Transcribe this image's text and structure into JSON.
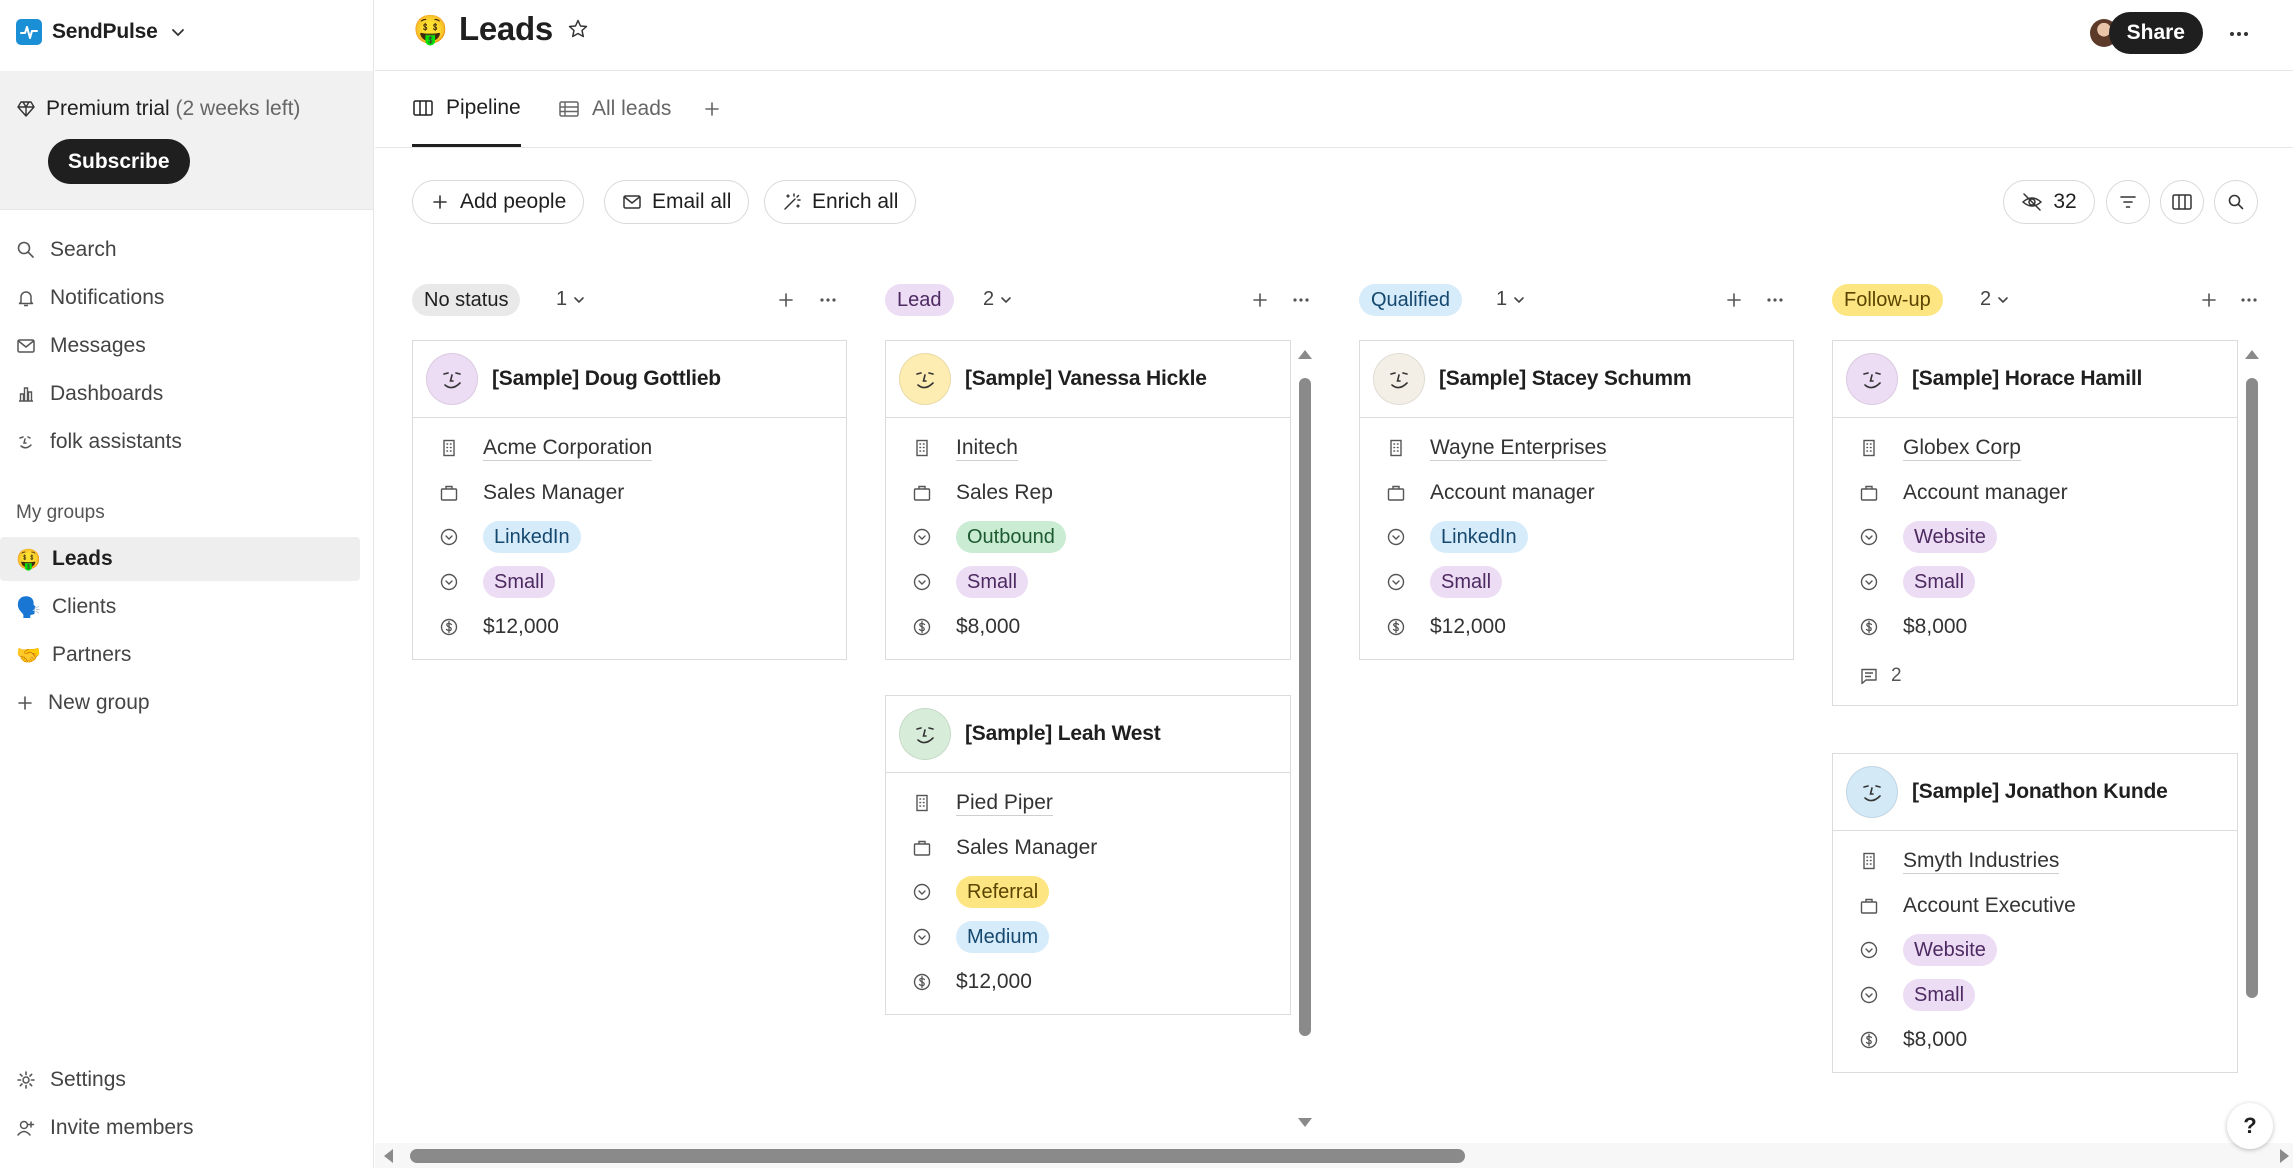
{
  "workspace": {
    "name": "SendPulse"
  },
  "trial": {
    "label": "Premium trial",
    "note": "(2 weeks left)",
    "subscribe_label": "Subscribe"
  },
  "nav": {
    "search": "Search",
    "notifications": "Notifications",
    "messages": "Messages",
    "dashboards": "Dashboards",
    "assistants": "folk assistants"
  },
  "groups": {
    "heading": "My groups",
    "items": [
      {
        "emoji": "🤑",
        "label": "Leads"
      },
      {
        "emoji": "🗣️",
        "label": "Clients"
      },
      {
        "emoji": "🤝",
        "label": "Partners"
      }
    ],
    "new_group": "New group"
  },
  "bottom_nav": {
    "settings": "Settings",
    "invite": "Invite members"
  },
  "header": {
    "emoji": "🤑",
    "title": "Leads",
    "share_label": "Share"
  },
  "tabs": [
    {
      "label": "Pipeline"
    },
    {
      "label": "All leads"
    }
  ],
  "toolbar": {
    "add_people": "Add people",
    "email_all": "Email all",
    "enrich_all": "Enrich all",
    "hidden_count": "32"
  },
  "colors": {
    "accent": "#1f1f1f",
    "tag_linkedin": "#d6ecfb",
    "tag_outbound": "#c9ecd3",
    "tag_small": "#ecdcf4",
    "tag_referral": "#fde681",
    "tag_medium": "#d6ecfb",
    "tag_website": "#ecdcf4",
    "status_no_status": "#e9e9e9",
    "status_lead": "#ecdcf4",
    "status_qualified": "#d6ecfb",
    "status_followup": "#fde681"
  },
  "columns": [
    {
      "status": "No status",
      "count": "1",
      "cards": [
        {
          "name": "[Sample] Doug Gottlieb",
          "company": "Acme Corporation",
          "role": "Sales Manager",
          "source": "LinkedIn",
          "size": "Small",
          "value": "$12,000"
        }
      ]
    },
    {
      "status": "Lead",
      "count": "2",
      "cards": [
        {
          "name": "[Sample] Vanessa Hickle",
          "company": "Initech",
          "role": "Sales Rep",
          "source": "Outbound",
          "size": "Small",
          "value": "$8,000"
        },
        {
          "name": "[Sample] Leah West",
          "company": "Pied Piper",
          "role": "Sales Manager",
          "source": "Referral",
          "size": "Medium",
          "value": "$12,000"
        }
      ]
    },
    {
      "status": "Qualified",
      "count": "1",
      "cards": [
        {
          "name": "[Sample] Stacey Schumm",
          "company": "Wayne Enterprises",
          "role": "Account manager",
          "source": "LinkedIn",
          "size": "Small",
          "value": "$12,000"
        }
      ]
    },
    {
      "status": "Follow-up",
      "count": "2",
      "cards": [
        {
          "name": "[Sample] Horace Hamill",
          "company": "Globex Corp",
          "role": "Account manager",
          "source": "Website",
          "size": "Small",
          "value": "$8,000",
          "comments": "2"
        },
        {
          "name": "[Sample] Jonathon Kunde",
          "company": "Smyth Industries",
          "role": "Account Executive",
          "source": "Website",
          "size": "Small",
          "value": "$8,000"
        }
      ]
    }
  ],
  "help_label": "?"
}
